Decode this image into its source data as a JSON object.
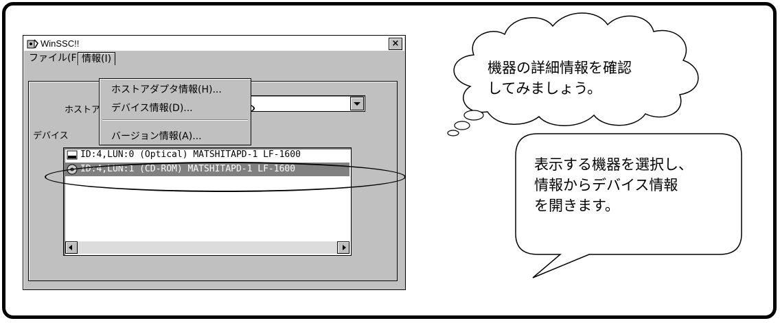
{
  "window": {
    "title": "WinSSC!!",
    "close_label": "×",
    "menu": [
      {
        "label": "ファイル(F)"
      },
      {
        "label": "情報(I)"
      }
    ],
    "host_label": "ホストア",
    "device_label": "デバイス",
    "dropdown_items": [
      {
        "label": "ホストアダプタ情報(H)..."
      },
      {
        "label": "デバイス情報(D)..."
      },
      {
        "label": "バージョン情報(A)..."
      }
    ],
    "devices": [
      {
        "label": "ID:4,LUN:0 (Optical) MATSHITAPD-1 LF-1600",
        "selected": false,
        "icon": "optical-drive-icon"
      },
      {
        "label": "ID:4,LUN:1 (CD-ROM) MATSHITAPD-1 LF-1600",
        "selected": true,
        "icon": "cd-rom-icon"
      }
    ]
  },
  "callouts": {
    "thought": [
      "機器の詳細情報を確認",
      "してみましょう。"
    ],
    "speech": [
      "表示する機器を選択し、",
      "情報からデバイス情報",
      "を開きます。"
    ]
  },
  "colors": {
    "window_bg": "#c0c0c0",
    "selection_bg": "#808080",
    "border": "#000000"
  }
}
